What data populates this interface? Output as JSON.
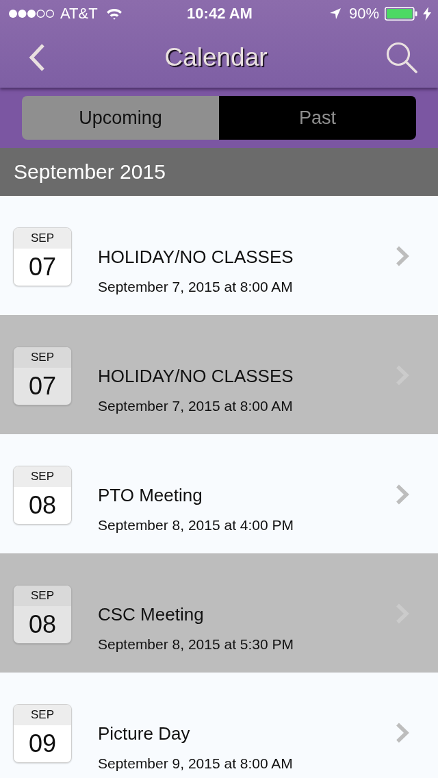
{
  "status_bar": {
    "carrier": "AT&T",
    "time": "10:42 AM",
    "battery": "90%"
  },
  "nav_bar": {
    "title": "Calendar"
  },
  "segments": [
    {
      "label": "Upcoming",
      "selected": true
    },
    {
      "label": "Past",
      "selected": false
    }
  ],
  "section": {
    "title": "September 2015"
  },
  "events": [
    {
      "month": "SEP",
      "day": "07",
      "title": "HOLIDAY/NO CLASSES",
      "when": "September 7, 2015 at 8:00 AM"
    },
    {
      "month": "SEP",
      "day": "07",
      "title": "HOLIDAY/NO CLASSES",
      "when": "September 7, 2015 at 8:00 AM"
    },
    {
      "month": "SEP",
      "day": "08",
      "title": "PTO Meeting",
      "when": "September 8, 2015 at 4:00 PM"
    },
    {
      "month": "SEP",
      "day": "08",
      "title": "CSC Meeting",
      "when": "September 8, 2015 at 5:30 PM"
    },
    {
      "month": "SEP",
      "day": "09",
      "title": "Picture Day",
      "when": "September 9, 2015 at 8:00 AM"
    }
  ]
}
